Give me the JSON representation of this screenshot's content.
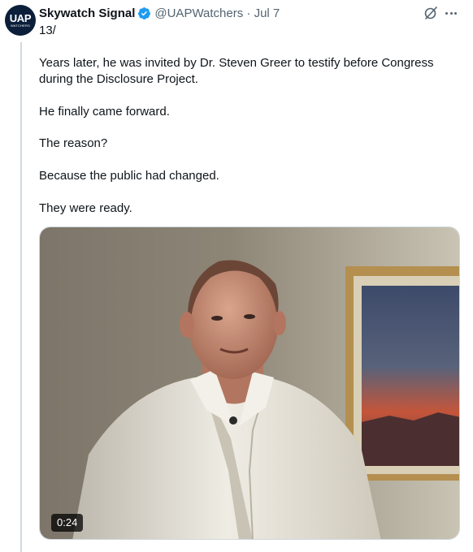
{
  "author": {
    "avatar_main": "UAP",
    "avatar_sub": "WATCHERS",
    "display_name": "Skywatch Signal",
    "handle_and_date": "@UAPWatchers · Jul 7"
  },
  "tweet": {
    "counter": "13/",
    "paragraphs": [
      "Years later, he was invited by Dr. Steven Greer to testify before Congress during the Disclosure Project.",
      "He finally came forward.",
      "The reason?",
      "Because the public had changed.",
      "They were ready."
    ]
  },
  "media": {
    "duration": "0:24"
  },
  "colors": {
    "verified": "#1d9bf0",
    "secondary_text": "#536471",
    "thread_line": "#cfd9de"
  },
  "icons": [
    "verified-badge-icon",
    "grok-icon",
    "more-icon"
  ]
}
